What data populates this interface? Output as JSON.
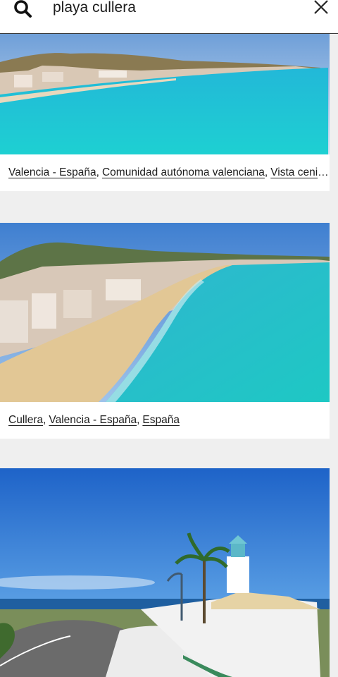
{
  "search": {
    "value": "playa cullera"
  },
  "results": [
    {
      "tags": [
        "Valencia - España",
        "Comunidad autónoma valenciana",
        "Vista ceni"
      ],
      "ellipsis": "…"
    },
    {
      "tags": [
        "Cullera",
        "Valencia - España",
        "España"
      ]
    },
    {
      "tags": []
    }
  ],
  "colors": {
    "sea": "#1ec6d6",
    "sky": "#3c8fdc",
    "sand": "#e3c79a",
    "text": "#1c1c1c"
  }
}
